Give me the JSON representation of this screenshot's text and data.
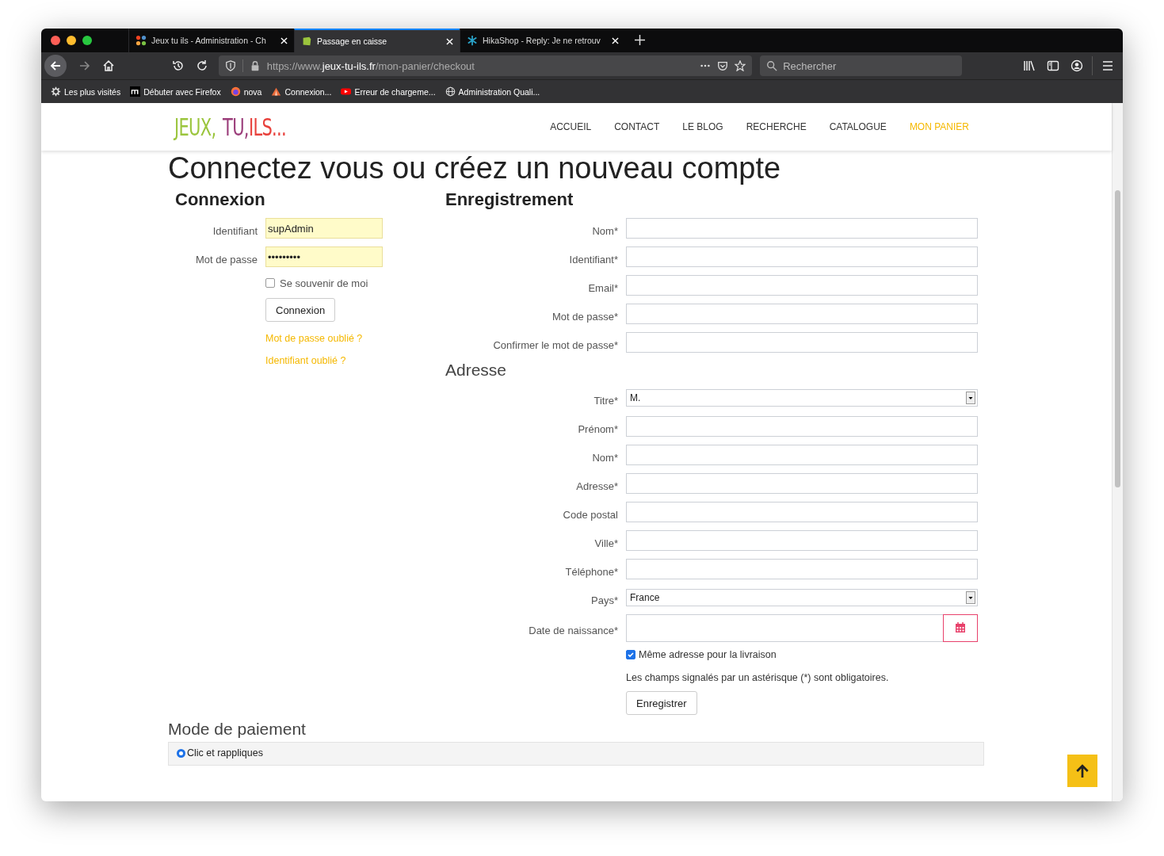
{
  "browser": {
    "tabs": [
      {
        "title": "Jeux tu ils - Administration - Ch",
        "selected": false
      },
      {
        "title": "Passage en caisse",
        "selected": true
      },
      {
        "title": "HikaShop - Reply: Je ne retrouv",
        "selected": false
      }
    ],
    "url": {
      "prefix": "https://www.",
      "domain": "jeux-tu-ils.fr",
      "path": "/mon-panier/checkout"
    },
    "search": {
      "placeholder": "Rechercher"
    },
    "bookmarks": [
      {
        "label": "Les plus visités"
      },
      {
        "label": "Débuter avec Firefox"
      },
      {
        "label": "nova"
      },
      {
        "label": "Connexion..."
      },
      {
        "label": "Erreur de chargeme..."
      },
      {
        "label": "Administration Quali..."
      }
    ]
  },
  "site": {
    "logo": [
      {
        "text": "JEUX,",
        "color": "#9bc53d"
      },
      {
        "text": "TU,",
        "color": "#9b3d7a"
      },
      {
        "text": "ILS...",
        "color": "#e8413c"
      }
    ],
    "nav": [
      {
        "label": "ACCUEIL",
        "selected": false
      },
      {
        "label": "CONTACT",
        "selected": false
      },
      {
        "label": "LE BLOG",
        "selected": false
      },
      {
        "label": "RECHERCHE",
        "selected": false
      },
      {
        "label": "CATALOGUE",
        "selected": false
      },
      {
        "label": "MON PANIER",
        "selected": true
      }
    ]
  },
  "title": "Connectez vous ou créez un nouveau compte",
  "login": {
    "heading": "Connexion",
    "fields": [
      {
        "label": "Identifiant",
        "value": "supAdmin"
      },
      {
        "label": "Mot de passe",
        "value": "•••••••••"
      }
    ],
    "remember": {
      "label": "Se souvenir de moi",
      "checked": false
    },
    "button": "Connexion",
    "links": [
      "Mot de passe oublié ?",
      "Identifiant oublié ?"
    ]
  },
  "register": {
    "heading": "Enregistrement",
    "fields": [
      {
        "label": "Nom*"
      },
      {
        "label": "Identifiant*"
      },
      {
        "label": "Email*"
      },
      {
        "label": "Mot de passe*"
      },
      {
        "label": "Confirmer le mot de passe*"
      }
    ],
    "address_heading": "Adresse",
    "address_fields": [
      {
        "label": "Titre*",
        "kind": "select",
        "value": "M."
      },
      {
        "label": "Prénom*",
        "kind": "text"
      },
      {
        "label": "Nom*",
        "kind": "text"
      },
      {
        "label": "Adresse*",
        "kind": "text"
      },
      {
        "label": "Code postal",
        "kind": "text"
      },
      {
        "label": "Ville*",
        "kind": "text"
      },
      {
        "label": "Téléphone*",
        "kind": "text"
      },
      {
        "label": "Pays*",
        "kind": "select",
        "value": "France"
      },
      {
        "label": "Date de naissance*",
        "kind": "date"
      }
    ],
    "same_address": {
      "label": "Même adresse pour la livraison",
      "checked": true
    },
    "note": "Les champs signalés par un astérisque (*) sont obligatoires.",
    "button": "Enregistrer"
  },
  "payment": {
    "heading": "Mode de paiement",
    "options": [
      {
        "label": "Clic et rappliques",
        "selected": true
      }
    ]
  }
}
